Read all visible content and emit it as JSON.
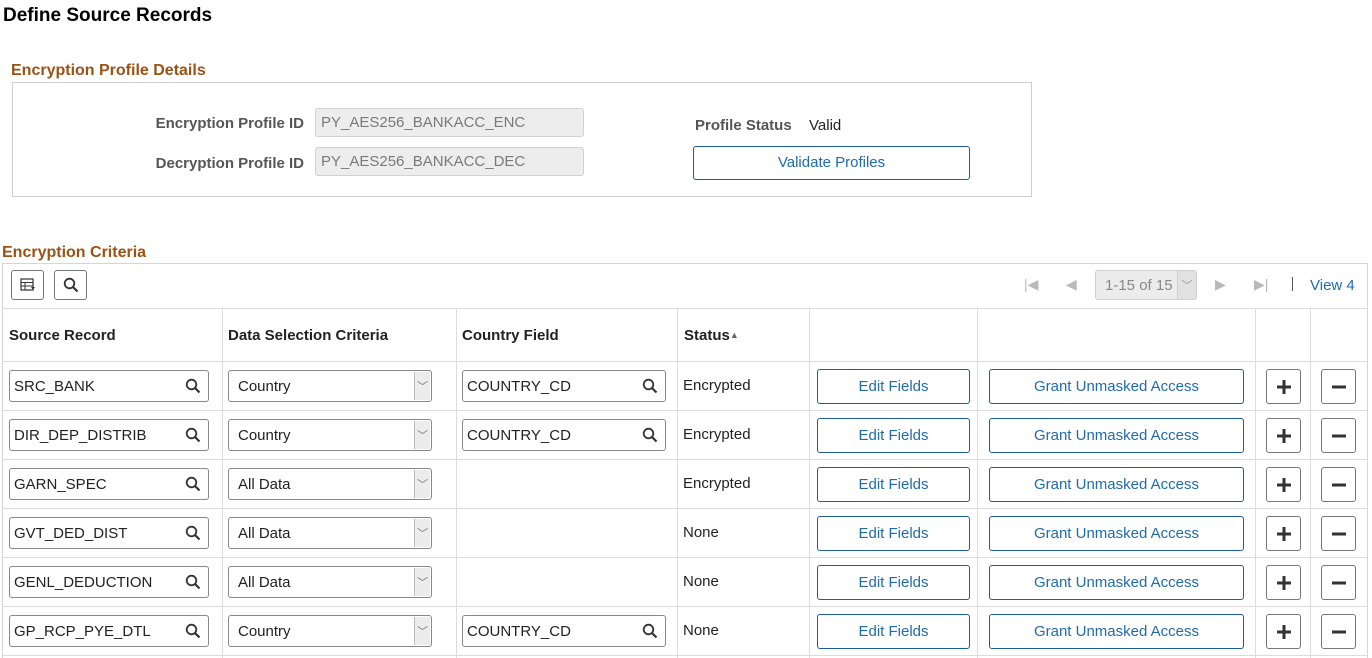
{
  "page": {
    "title": "Define Source Records"
  },
  "profile_section": {
    "title": "Encryption Profile Details",
    "encryption_label": "Encryption Profile ID",
    "encryption_value": "PY_AES256_BANKACC_ENC",
    "decryption_label": "Decryption Profile ID",
    "decryption_value": "PY_AES256_BANKACC_DEC",
    "status_label": "Profile Status",
    "status_value": "Valid",
    "validate_label": "Validate Profiles"
  },
  "criteria_section": {
    "title": "Encryption Criteria",
    "pagination": {
      "range": "1-15 of 15",
      "view_all": "View 4"
    },
    "columns": {
      "source_record": "Source Record",
      "data_selection": "Data Selection Criteria",
      "country_field": "Country Field",
      "status": "Status"
    },
    "edit_label": "Edit Fields",
    "grant_label": "Grant Unmasked Access",
    "rows": [
      {
        "source_record": "SRC_BANK",
        "data_selection": "Country",
        "country_field": "COUNTRY_CD",
        "status": "Encrypted"
      },
      {
        "source_record": "DIR_DEP_DISTRIB",
        "data_selection": "Country",
        "country_field": "COUNTRY_CD",
        "status": "Encrypted"
      },
      {
        "source_record": "GARN_SPEC",
        "data_selection": "All Data",
        "country_field": "",
        "status": "Encrypted"
      },
      {
        "source_record": "GVT_DED_DIST",
        "data_selection": "All Data",
        "country_field": "",
        "status": "None"
      },
      {
        "source_record": "GENL_DEDUCTION",
        "data_selection": "All Data",
        "country_field": "",
        "status": "None"
      },
      {
        "source_record": "GP_RCP_PYE_DTL",
        "data_selection": "Country",
        "country_field": "COUNTRY_CD",
        "status": "None"
      }
    ]
  },
  "icons": {
    "grid_view": "grid-personalize-icon",
    "search": "search-icon",
    "first": "first-page-icon",
    "prev": "previous-page-icon",
    "next": "next-page-icon",
    "last": "last-page-icon",
    "add": "plus-icon",
    "delete": "minus-icon",
    "sort": "sort-ascending-icon"
  },
  "colors": {
    "section_title": "#9c5215",
    "link": "#1f6bb0",
    "button_border": "#1b5e9b"
  }
}
